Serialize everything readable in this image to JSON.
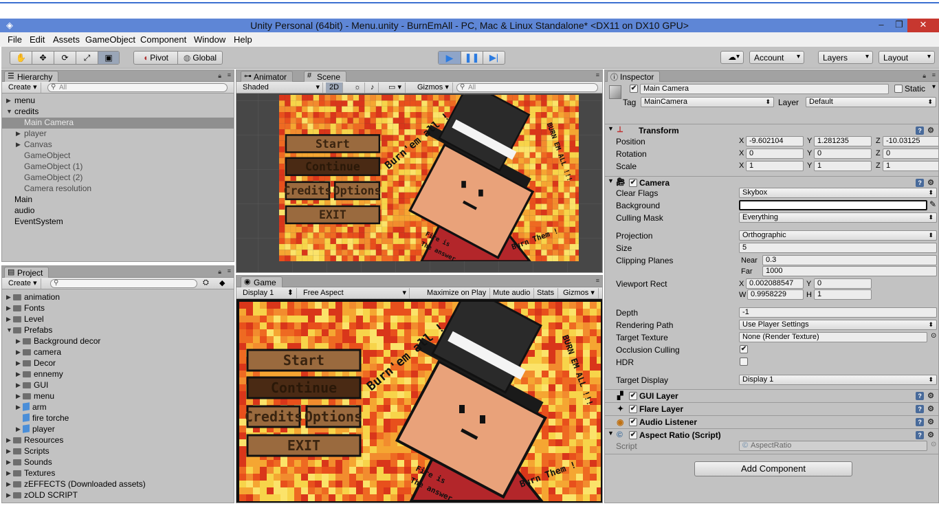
{
  "window": {
    "title": "Unity Personal (64bit) - Menu.unity - BurnEmAll - PC, Mac & Linux Standalone* <DX11 on DX10 GPU>",
    "minimize": "–",
    "restore": "❐",
    "close": "✕"
  },
  "menu": [
    "File",
    "Edit",
    "Assets",
    "GameObject",
    "Component",
    "Window",
    "Help"
  ],
  "toolbar": {
    "tools": [
      "hand-tool",
      "move-tool",
      "rotate-tool",
      "scale-tool",
      "rect-tool"
    ],
    "pivot": "Pivot",
    "global": "Global",
    "account": "Account",
    "layers": "Layers",
    "layout": "Layout"
  },
  "hierarchy": {
    "tab": "Hierarchy",
    "create": "Create",
    "search_placeholder": "All",
    "items": [
      {
        "label": "menu",
        "indent": 0,
        "arrow": "▶",
        "selected": false
      },
      {
        "label": "credits",
        "indent": 0,
        "arrow": "▼",
        "selected": false
      },
      {
        "label": "Main Camera",
        "indent": 1,
        "arrow": "",
        "selected": true
      },
      {
        "label": "player",
        "indent": 1,
        "arrow": "▶",
        "selected": false
      },
      {
        "label": "Canvas",
        "indent": 1,
        "arrow": "▶",
        "selected": false
      },
      {
        "label": "GameObject",
        "indent": 1,
        "arrow": "",
        "selected": false
      },
      {
        "label": "GameObject (1)",
        "indent": 1,
        "arrow": "",
        "selected": false
      },
      {
        "label": "GameObject (2)",
        "indent": 1,
        "arrow": "",
        "selected": false
      },
      {
        "label": "Camera resolution",
        "indent": 1,
        "arrow": "",
        "selected": false
      },
      {
        "label": "Main",
        "indent": 0,
        "arrow": "",
        "selected": false
      },
      {
        "label": "audio",
        "indent": 0,
        "arrow": "",
        "selected": false
      },
      {
        "label": "EventSystem",
        "indent": 0,
        "arrow": "",
        "selected": false
      }
    ]
  },
  "project": {
    "tab": "Project",
    "create": "Create",
    "items": [
      {
        "label": "animation",
        "indent": 0,
        "type": "folder"
      },
      {
        "label": "Fonts",
        "indent": 0,
        "type": "folder"
      },
      {
        "label": "Level",
        "indent": 0,
        "type": "folder"
      },
      {
        "label": "Prefabs",
        "indent": 0,
        "type": "folder-open"
      },
      {
        "label": "Background decor",
        "indent": 1,
        "type": "folder"
      },
      {
        "label": "camera",
        "indent": 1,
        "type": "folder"
      },
      {
        "label": "Decor",
        "indent": 1,
        "type": "folder"
      },
      {
        "label": "ennemy",
        "indent": 1,
        "type": "folder"
      },
      {
        "label": "GUI",
        "indent": 1,
        "type": "folder"
      },
      {
        "label": "menu",
        "indent": 1,
        "type": "folder"
      },
      {
        "label": "arm",
        "indent": 1,
        "type": "prefab"
      },
      {
        "label": "fire torche",
        "indent": 1,
        "type": "prefab-leaf"
      },
      {
        "label": "player",
        "indent": 1,
        "type": "prefab"
      },
      {
        "label": "Resources",
        "indent": 0,
        "type": "folder"
      },
      {
        "label": "Scripts",
        "indent": 0,
        "type": "folder"
      },
      {
        "label": "Sounds",
        "indent": 0,
        "type": "folder"
      },
      {
        "label": "Textures",
        "indent": 0,
        "type": "folder"
      },
      {
        "label": "zEFFECTS (Downloaded assets)",
        "indent": 0,
        "type": "folder"
      },
      {
        "label": "zOLD SCRIPT",
        "indent": 0,
        "type": "folder"
      }
    ]
  },
  "scene": {
    "tab_animator": "Animator",
    "tab_scene": "Scene",
    "shaded": "Shaded",
    "mode_2d": "2D",
    "gizmos": "Gizmos",
    "search_placeholder": "All"
  },
  "game": {
    "tab": "Game",
    "display": "Display 1",
    "aspect": "Free Aspect",
    "maximize": "Maximize on Play",
    "mute": "Mute audio",
    "stats": "Stats",
    "gizmos": "Gizmos"
  },
  "menu_art": {
    "start": "Start",
    "continue": "Continue",
    "credits": "Credits",
    "options": "Options",
    "exit": "EXIT",
    "burn_em_all": "Burn'em all !",
    "burn_em_all_side": "BURN EM ALL !!!",
    "burn_them": "Burn Them !",
    "fire_is": "Fire is",
    "the_answer": "The answer"
  },
  "inspector": {
    "tab": "Inspector",
    "object_name": "Main Camera",
    "static": "Static",
    "tag_label": "Tag",
    "tag": "MainCamera",
    "layer_label": "Layer",
    "layer": "Default",
    "transform": {
      "title": "Transform",
      "position_label": "Position",
      "rotation_label": "Rotation",
      "scale_label": "Scale",
      "position": [
        "-9.602104",
        "1.281235",
        "-10.03125"
      ],
      "rotation": [
        "0",
        "0",
        "0"
      ],
      "scale": [
        "1",
        "1",
        "1"
      ]
    },
    "camera": {
      "title": "Camera",
      "clear_flags_label": "Clear Flags",
      "clear_flags": "Skybox",
      "background_label": "Background",
      "culling_mask_label": "Culling Mask",
      "culling_mask": "Everything",
      "projection_label": "Projection",
      "projection": "Orthographic",
      "size_label": "Size",
      "size": "5",
      "clipping_label": "Clipping Planes",
      "near_label": "Near",
      "near": "0.3",
      "far_label": "Far",
      "far": "1000",
      "viewport_label": "Viewport Rect",
      "vp_x": "0.002088547",
      "vp_y": "0",
      "vp_w": "0.9958229",
      "vp_h": "1",
      "depth_label": "Depth",
      "depth": "-1",
      "rendering_path_label": "Rendering Path",
      "rendering_path": "Use Player Settings",
      "target_texture_label": "Target Texture",
      "target_texture": "None (Render Texture)",
      "occlusion_label": "Occlusion Culling",
      "hdr_label": "HDR",
      "target_display_label": "Target Display",
      "target_display": "Display 1"
    },
    "gui_layer": "GUI Layer",
    "flare_layer": "Flare Layer",
    "audio_listener": "Audio Listener",
    "aspect_ratio": "Aspect Ratio (Script)",
    "script_label": "Script",
    "script_value": "AspectRatio",
    "add_component": "Add Component"
  },
  "colors": {
    "title_bar": "#5e86d6",
    "play_active": "#2c7be0",
    "panel_bg": "#c2c2c2",
    "selection": "#8f8f8f"
  }
}
